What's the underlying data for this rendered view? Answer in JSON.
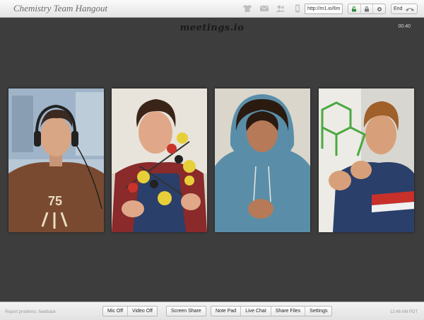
{
  "header": {
    "title": "Chemistry Team Hangout",
    "url": "http://m1.io/6m",
    "end_label": "End",
    "icons": [
      "shirt-icon",
      "mail-icon",
      "people-icon",
      "phone-device-icon",
      "lock-icon",
      "lock-icon",
      "lock-icon",
      "hangup-icon"
    ]
  },
  "stage": {
    "brand": "meetings.io",
    "timer": "00:40",
    "participants": [
      {
        "shirt_color": "#7a4a30"
      },
      {
        "shirt_color": "#8a2a2a"
      },
      {
        "shirt_color": "#5a8ea8"
      },
      {
        "shirt_color": "#2a3f6a"
      }
    ]
  },
  "footer": {
    "report_text": "Report problems, feedback",
    "clock": "12:48 AM PDT",
    "groups": [
      {
        "buttons": [
          "Mic Off",
          "Video Off"
        ]
      },
      {
        "buttons": [
          "Screen Share"
        ]
      },
      {
        "buttons": [
          "Note Pad",
          "Live Chat",
          "Share Files",
          "Settings"
        ]
      }
    ]
  }
}
